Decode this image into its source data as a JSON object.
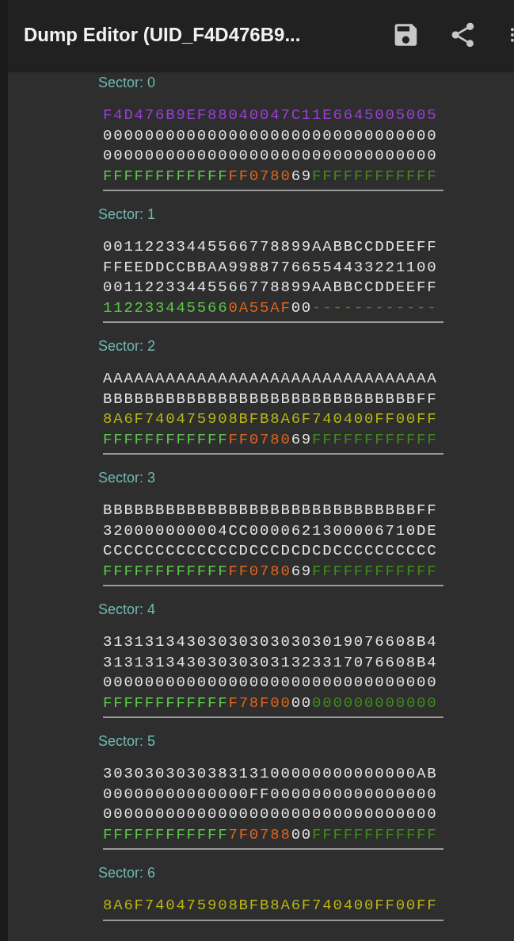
{
  "app_bar": {
    "title": "Dump Editor (UID_F4D476B9..."
  },
  "sectors": [
    {
      "label": "Sector: 0",
      "rows": [
        [
          {
            "kind": "uid",
            "text": "F4D476B9EF88040047C11E6645005005"
          }
        ],
        [
          {
            "kind": "data",
            "text": "00000000000000000000000000000000"
          }
        ],
        [
          {
            "kind": "data",
            "text": "00000000000000000000000000000000"
          }
        ],
        [
          {
            "kind": "keya",
            "text": "FFFFFFFFFFFF"
          },
          {
            "kind": "access",
            "text": "FF0780"
          },
          {
            "kind": "gpb",
            "text": "69"
          },
          {
            "kind": "keyb",
            "text": "FFFFFFFFFFFF"
          }
        ]
      ]
    },
    {
      "label": "Sector: 1",
      "rows": [
        [
          {
            "kind": "data",
            "text": "00112233445566778899AABBCCDDEEFF"
          }
        ],
        [
          {
            "kind": "data",
            "text": "FFEEDDCCBBAA99887766554433221100"
          }
        ],
        [
          {
            "kind": "data",
            "text": "00112233445566778899AABBCCDDEEFF"
          }
        ],
        [
          {
            "kind": "keya",
            "text": "112233445566"
          },
          {
            "kind": "access",
            "text": "0A55AF"
          },
          {
            "kind": "gpb",
            "text": "00"
          },
          {
            "kind": "keyb",
            "text": "------------"
          }
        ]
      ]
    },
    {
      "label": "Sector: 2",
      "rows": [
        [
          {
            "kind": "data",
            "text": "AAAAAAAAAAAAAAAAAAAAAAAAAAAAAAAA"
          }
        ],
        [
          {
            "kind": "data",
            "text": "BBBBBBBBBBBBBBBBBBBBBBBBBBBBBBFF"
          }
        ],
        [
          {
            "kind": "value",
            "text": "8A6F740475908BFB8A6F740400FF00FF"
          }
        ],
        [
          {
            "kind": "keya",
            "text": "FFFFFFFFFFFF"
          },
          {
            "kind": "access",
            "text": "FF0780"
          },
          {
            "kind": "gpb",
            "text": "69"
          },
          {
            "kind": "keyb",
            "text": "FFFFFFFFFFFF"
          }
        ]
      ]
    },
    {
      "label": "Sector: 3",
      "rows": [
        [
          {
            "kind": "data",
            "text": "BBBBBBBBBBBBBBBBBBBBBBBBBBBBBBFF"
          }
        ],
        [
          {
            "kind": "data",
            "text": "320000000004CC0000621300006710DE"
          }
        ],
        [
          {
            "kind": "data",
            "text": "CCCCCCCCCCCCCDCCCDCDCDCCCCCCCCCC"
          }
        ],
        [
          {
            "kind": "keya",
            "text": "FFFFFFFFFFFF"
          },
          {
            "kind": "access",
            "text": "FF0780"
          },
          {
            "kind": "gpb",
            "text": "69"
          },
          {
            "kind": "keyb",
            "text": "FFFFFFFFFFFF"
          }
        ]
      ]
    },
    {
      "label": "Sector: 4",
      "rows": [
        [
          {
            "kind": "data",
            "text": "313131343030303030303019076608B4"
          }
        ],
        [
          {
            "kind": "data",
            "text": "313131343030303031323317076608B4"
          }
        ],
        [
          {
            "kind": "data",
            "text": "00000000000000000000000000000000"
          }
        ],
        [
          {
            "kind": "keya",
            "text": "FFFFFFFFFFFF"
          },
          {
            "kind": "access",
            "text": "F78F00"
          },
          {
            "kind": "gpb",
            "text": "00"
          },
          {
            "kind": "keyb",
            "text": "000000000000"
          }
        ]
      ]
    },
    {
      "label": "Sector: 5",
      "rows": [
        [
          {
            "kind": "data",
            "text": "303030303038313100000000000000AB"
          }
        ],
        [
          {
            "kind": "data",
            "text": "00000000000000FF0000000000000000"
          }
        ],
        [
          {
            "kind": "data",
            "text": "00000000000000000000000000000000"
          }
        ],
        [
          {
            "kind": "keya",
            "text": "FFFFFFFFFFFF"
          },
          {
            "kind": "access",
            "text": "7F0788"
          },
          {
            "kind": "gpb",
            "text": "00"
          },
          {
            "kind": "keyb",
            "text": "FFFFFFFFFFFF"
          }
        ]
      ]
    },
    {
      "label": "Sector: 6",
      "rows": [
        [
          {
            "kind": "value",
            "text": "8A6F740475908BFB8A6F740400FF00FF"
          }
        ]
      ]
    }
  ]
}
